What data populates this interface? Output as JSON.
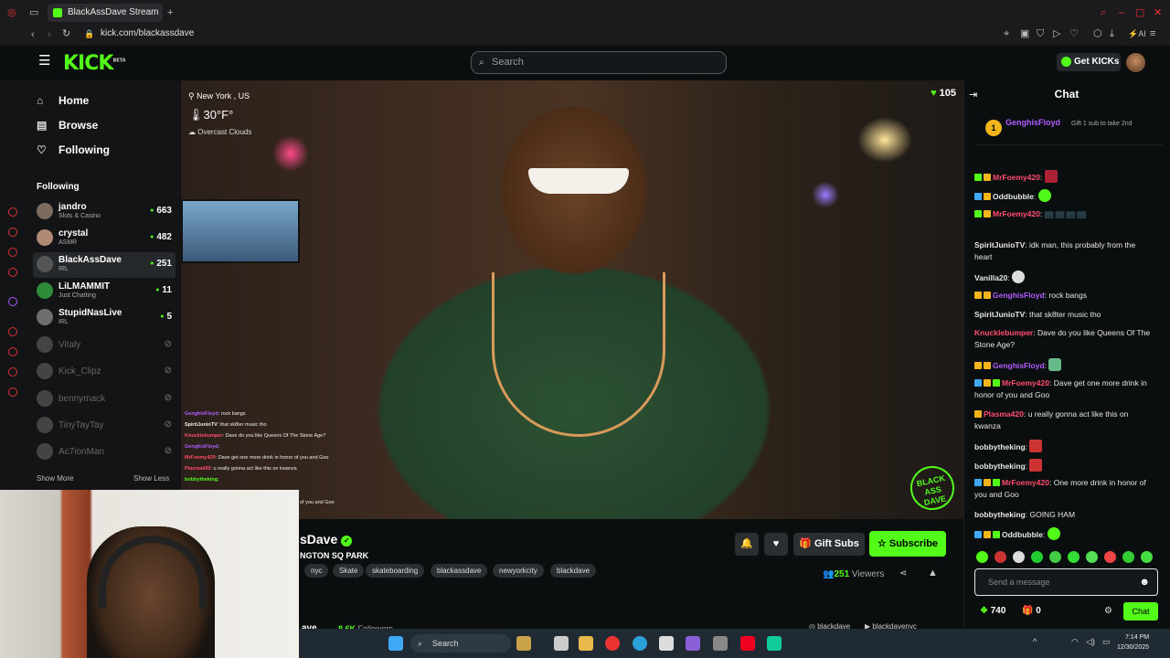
{
  "browser": {
    "tab_title": "BlackAssDave Stream",
    "url": "kick.com/blackassdave"
  },
  "header": {
    "logo": "KICK",
    "logo_badge": "BETA",
    "search_placeholder": "Search",
    "get_kicks_label": "Get KICKs"
  },
  "sidebar": {
    "nav": [
      {
        "label": "Home",
        "icon": "home-icon"
      },
      {
        "label": "Browse",
        "icon": "browse-icon"
      },
      {
        "label": "Following",
        "icon": "heart-icon"
      }
    ],
    "following_heading": "Following",
    "channels": [
      {
        "name": "jandro",
        "category": "Slots & Casino",
        "viewers": "663",
        "live": true
      },
      {
        "name": "crystal",
        "category": "ASMR",
        "viewers": "482",
        "live": true
      },
      {
        "name": "BlackAssDave",
        "category": "IRL",
        "viewers": "251",
        "live": true
      },
      {
        "name": "LiLMAMMIT",
        "category": "Just Chatting",
        "viewers": "11",
        "live": true
      },
      {
        "name": "StupidNasLive",
        "category": "IRL",
        "viewers": "5",
        "live": true
      },
      {
        "name": "Vitaly",
        "category": "",
        "viewers": "",
        "live": false
      },
      {
        "name": "Kick_Clipz",
        "category": "",
        "viewers": "",
        "live": false
      },
      {
        "name": "bennymack",
        "category": "",
        "viewers": "",
        "live": false
      },
      {
        "name": "TinyTayTay",
        "category": "",
        "viewers": "",
        "live": false
      },
      {
        "name": "Ac7ionMan",
        "category": "",
        "viewers": "",
        "live": false
      }
    ],
    "show_more": "Show More",
    "show_less": "Show Less"
  },
  "video": {
    "location": "New York , US",
    "temperature": "30°F°",
    "weather": "Overcast Clouds",
    "viewer_count": "105",
    "overlay_chat": [
      {
        "user": "GenghisFloyd",
        "text": "rock bangs"
      },
      {
        "user": "SpiritJunioTV",
        "text": "that sk8ter music tho"
      },
      {
        "user": "Knucklebumper",
        "text": "Dave do you like Queens Of The Stone Age?"
      },
      {
        "user": "GenghisFloyd",
        "text": ""
      },
      {
        "user": "MrFoemy420",
        "text": "Dave get one more drink in honor of you and Goo"
      },
      {
        "user": "Plasma420",
        "text": "u really gonna act like this on kwanza"
      },
      {
        "user": "bobbytheking",
        "text": ""
      }
    ],
    "overlay_footer": "of you and Goo",
    "watermark": "BLACK ASS DAVE"
  },
  "stream": {
    "channel_name": "sDave",
    "title": "NGTON SQ PARK",
    "tags": [
      "nyc",
      "Skate",
      "skateboarding",
      "blackassdave",
      "newyorkcity",
      "blackdave"
    ],
    "gift_subs_label": "Gift Subs",
    "subscribe_label": "Subscribe",
    "viewers": "251",
    "viewers_label": "Viewers",
    "about_name": "ave",
    "followers": "8.6K",
    "followers_label": "Followers",
    "social_instagram": "blackdave",
    "social_youtube": "blackdavenyc"
  },
  "chat": {
    "title": "Chat",
    "pinned_user": "GenghisFloyd",
    "pinned_count": "1",
    "pinned_text": "Gift 1 sub to take 2nd",
    "messages": [
      {
        "user": "MrFoemy420",
        "color": "#ff4d6d",
        "text": ""
      },
      {
        "user": "Oddbubble",
        "color": "#e6e6e6",
        "text": ""
      },
      {
        "user": "MrFoemy420",
        "color": "#ff4d6d",
        "text": ""
      },
      {
        "user": "SpiritJunioTV",
        "color": "#e6e6e6",
        "text": "idk man, this probably from the heart"
      },
      {
        "user": "Vanilla20",
        "color": "#e6e6e6",
        "text": ""
      },
      {
        "user": "GenghisFloyd",
        "color": "#b15cff",
        "text": "rock bangs"
      },
      {
        "user": "SpiritJunioTV",
        "color": "#e6e6e6",
        "text": "that sk8ter music tho"
      },
      {
        "user": "Knucklebumper",
        "color": "#ff4d6d",
        "text": "Dave do you like Queens Of The Stone Age?"
      },
      {
        "user": "GenghisFloyd",
        "color": "#b15cff",
        "text": ""
      },
      {
        "user": "MrFoemy420",
        "color": "#ff4d6d",
        "text": "Dave get one more drink in honor of you and Goo"
      },
      {
        "user": "Plasma420",
        "color": "#ff4d6d",
        "text": "u really gonna act like this on kwanza"
      },
      {
        "user": "bobbytheking",
        "color": "#e6e6e6",
        "text": ""
      },
      {
        "user": "bobbytheking",
        "color": "#e6e6e6",
        "text": ""
      },
      {
        "user": "MrFoemy420",
        "color": "#ff4d6d",
        "text": "One more drink in honor of you and Goo"
      },
      {
        "user": "bobbytheking",
        "color": "#e6e6e6",
        "text": "GOING HAM"
      },
      {
        "user": "Oddbubble",
        "color": "#e6e6e6",
        "text": ""
      }
    ],
    "input_placeholder": "Send a message",
    "kicks_balance": "740",
    "gift_count": "0",
    "send_label": "Chat"
  },
  "taskbar": {
    "search_label": "Search",
    "time": "7:14 PM",
    "date": "12/30/2025"
  },
  "colors": {
    "accent": "#53fc18",
    "background": "#0b0e0f"
  }
}
